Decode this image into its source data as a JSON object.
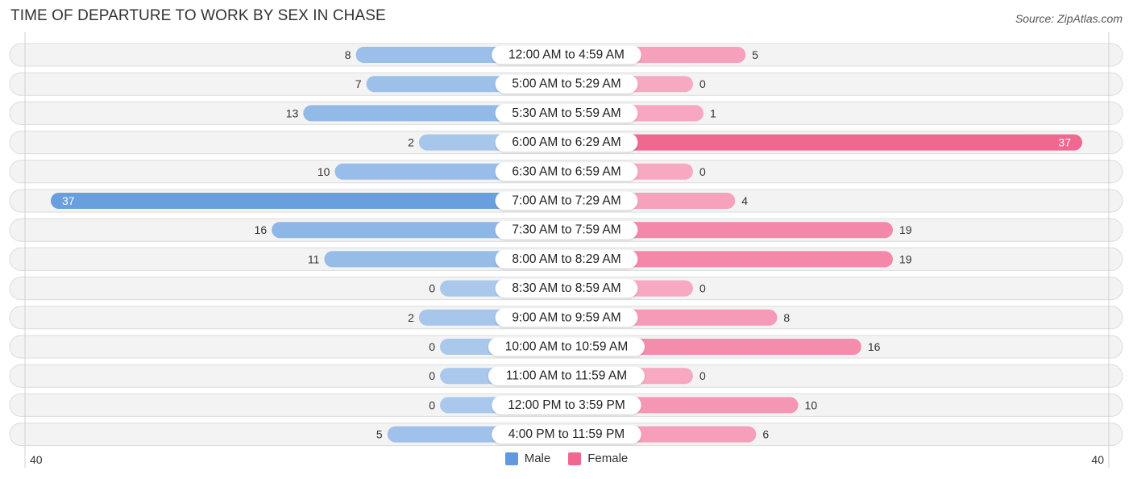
{
  "title": "TIME OF DEPARTURE TO WORK BY SEX IN CHASE",
  "source": "Source: ZipAtlas.com",
  "colors": {
    "male": "#6a9fdd",
    "male_light": "#a9c8ec",
    "female": "#f06890",
    "female_light": "#f7a9c2",
    "row_bg": "#f3f3f3"
  },
  "legend": [
    {
      "label": "Male",
      "color": "#5f9ae0"
    },
    {
      "label": "Female",
      "color": "#f06890"
    }
  ],
  "axis": {
    "left_label": "40",
    "right_label": "40"
  },
  "chart_data": {
    "type": "bar",
    "orientation": "horizontal-diverging",
    "title": "TIME OF DEPARTURE TO WORK BY SEX IN CHASE",
    "categories": [
      "12:00 AM to 4:59 AM",
      "5:00 AM to 5:29 AM",
      "5:30 AM to 5:59 AM",
      "6:00 AM to 6:29 AM",
      "6:30 AM to 6:59 AM",
      "7:00 AM to 7:29 AM",
      "7:30 AM to 7:59 AM",
      "8:00 AM to 8:29 AM",
      "8:30 AM to 8:59 AM",
      "9:00 AM to 9:59 AM",
      "10:00 AM to 10:59 AM",
      "11:00 AM to 11:59 AM",
      "12:00 PM to 3:59 PM",
      "4:00 PM to 11:59 PM"
    ],
    "series": [
      {
        "name": "Male",
        "values": [
          8,
          7,
          13,
          2,
          10,
          37,
          16,
          11,
          0,
          2,
          0,
          0,
          0,
          5
        ]
      },
      {
        "name": "Female",
        "values": [
          5,
          0,
          1,
          37,
          0,
          4,
          19,
          19,
          0,
          8,
          16,
          0,
          10,
          6
        ]
      }
    ],
    "xlim": [
      -40,
      40
    ],
    "xtick_labels": [
      "40",
      "40"
    ],
    "legend_position": "bottom-center",
    "grid": false
  }
}
